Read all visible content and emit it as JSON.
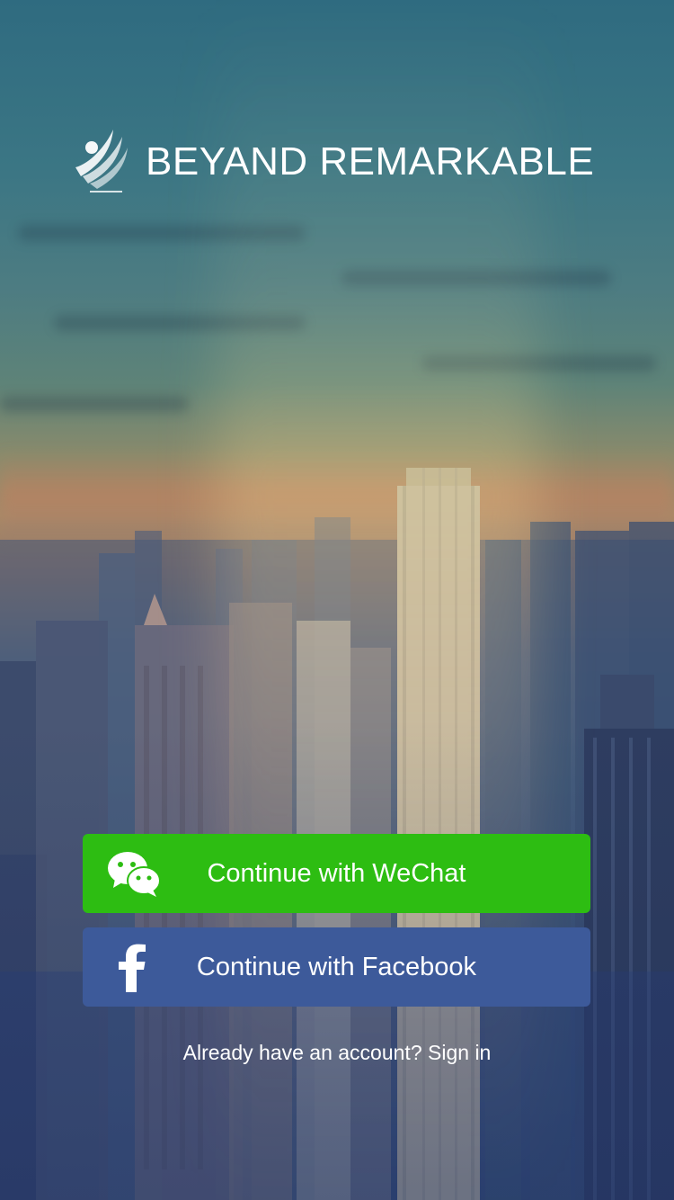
{
  "brand": {
    "name": "BEYAND REMARKABLE",
    "logo_icon": "swoosh-logo-icon"
  },
  "actions": {
    "wechat": {
      "label": "Continue with WeChat",
      "icon": "wechat-icon",
      "color": "#2dbd12"
    },
    "facebook": {
      "label": "Continue with Facebook",
      "icon": "facebook-icon",
      "color": "#3d5a9a"
    }
  },
  "signin": {
    "prompt": "Already have an account?",
    "link_label": "Sign in"
  },
  "background": {
    "scene": "city-skyline-background"
  }
}
